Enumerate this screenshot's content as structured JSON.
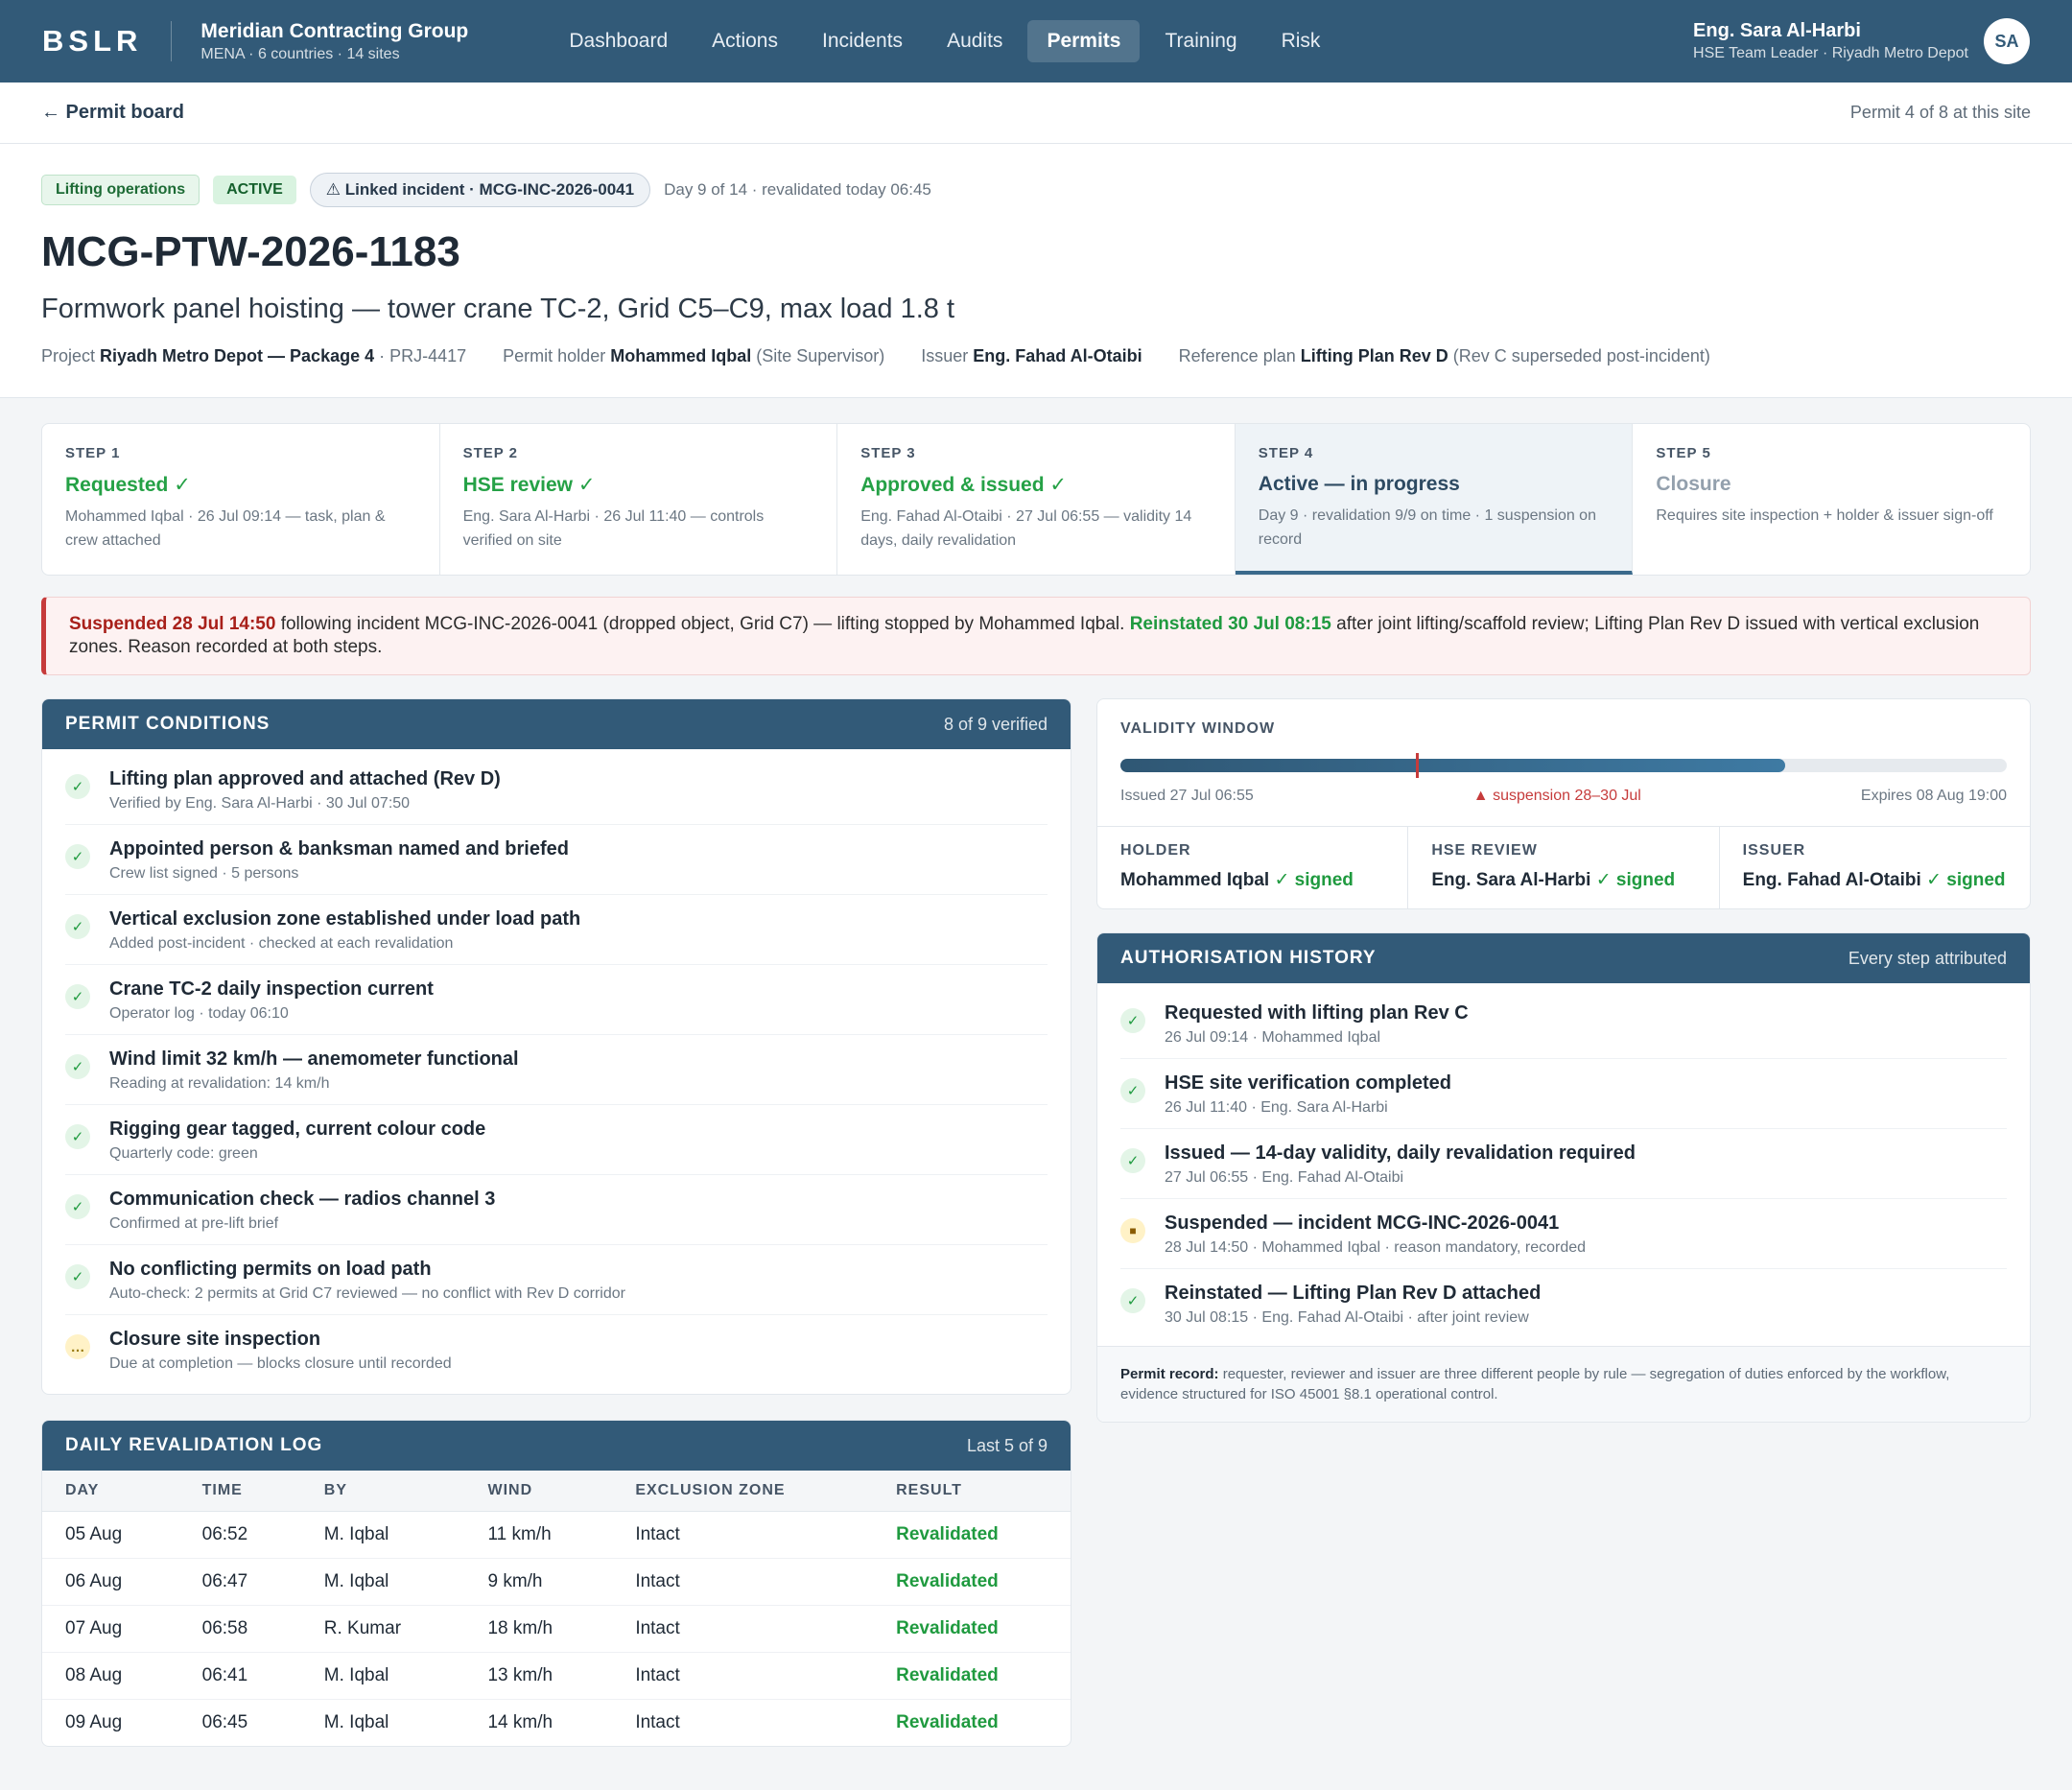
{
  "topbar": {
    "logo": "BSLR",
    "org_name": "Meridian Contracting Group",
    "org_sub": "MENA · 6 countries · 14 sites",
    "nav": [
      "Dashboard",
      "Actions",
      "Incidents",
      "Audits",
      "Permits",
      "Training",
      "Risk"
    ],
    "active_nav": "Permits",
    "user_name": "Eng. Sara Al-Harbi",
    "user_role": "HSE Team Leader · Riyadh Metro Depot",
    "avatar": "SA"
  },
  "subbar": {
    "back": "← Permit board",
    "position": "Permit 4 of 8 at this site"
  },
  "header": {
    "tag_type": "Lifting operations",
    "tag_status": "ACTIVE",
    "tag_incident": "⚠ Linked incident · MCG-INC-2026-0041",
    "day_meta": "Day 9 of 14 · revalidated today 06:45",
    "title": "MCG-PTW-2026-1183",
    "subtitle": "Formwork panel hoisting — tower crane TC-2, Grid C5–C9, max load 1.8 t",
    "project_label": "Project ",
    "project_value": "Riyadh Metro Depot — Package 4",
    "project_code": " · PRJ-4417",
    "holder_label": "Permit holder ",
    "holder_value": "Mohammed Iqbal",
    "holder_role": " (Site Supervisor)",
    "issuer_label": "Issuer ",
    "issuer_value": "Eng. Fahad Al-Otaibi",
    "plan_label": "Reference plan ",
    "plan_value": "Lifting Plan Rev D",
    "plan_note": " (Rev C superseded post-incident)"
  },
  "steps": [
    {
      "num": "STEP 1",
      "title": "Requested ✓",
      "desc": "Mohammed Iqbal · 26 Jul 09:14 — task, plan & crew attached",
      "state": "done"
    },
    {
      "num": "STEP 2",
      "title": "HSE review ✓",
      "desc": "Eng. Sara Al-Harbi · 26 Jul 11:40 — controls verified on site",
      "state": "done"
    },
    {
      "num": "STEP 3",
      "title": "Approved & issued ✓",
      "desc": "Eng. Fahad Al-Otaibi · 27 Jul 06:55 — validity 14 days, daily revalidation",
      "state": "done"
    },
    {
      "num": "STEP 4",
      "title": "Active — in progress",
      "desc": "Day 9 · revalidation 9/9 on time · 1 suspension on record",
      "state": "current"
    },
    {
      "num": "STEP 5",
      "title": "Closure",
      "desc": "Requires site inspection + holder & issuer sign-off",
      "state": "pending"
    }
  ],
  "alert": {
    "susp": "Suspended 28 Jul 14:50",
    "text1": " following incident MCG-INC-2026-0041 (dropped object, Grid C7) — lifting stopped by Mohammed Iqbal. ",
    "reinst": "Reinstated 30 Jul 08:15",
    "text2": " after joint lifting/scaffold review; Lifting Plan Rev D issued with vertical exclusion zones. Reason recorded at both steps."
  },
  "conditions": {
    "title": "PERMIT CONDITIONS",
    "aside": "8 of 9 verified",
    "items": [
      {
        "title": "Lifting plan approved and attached (Rev D)",
        "sub": "Verified by Eng. Sara Al-Harbi · 30 Jul 07:50",
        "icon": "✓"
      },
      {
        "title": "Appointed person & banksman named and briefed",
        "sub": "Crew list signed · 5 persons",
        "icon": "✓"
      },
      {
        "title": "Vertical exclusion zone established under load path",
        "sub": "Added post-incident · checked at each revalidation",
        "icon": "✓"
      },
      {
        "title": "Crane TC-2 daily inspection current",
        "sub": "Operator log · today 06:10",
        "icon": "✓"
      },
      {
        "title": "Wind limit 32 km/h — anemometer functional",
        "sub": "Reading at revalidation: 14 km/h",
        "icon": "✓"
      },
      {
        "title": "Rigging gear tagged, current colour code",
        "sub": "Quarterly code: green",
        "icon": "✓"
      },
      {
        "title": "Communication check — radios channel 3",
        "sub": "Confirmed at pre-lift brief",
        "icon": "✓"
      },
      {
        "title": "No conflicting permits on load path",
        "sub": "Auto-check: 2 permits at Grid C7 reviewed — no conflict with Rev D corridor",
        "icon": "✓"
      },
      {
        "title": "Closure site inspection",
        "sub": "Due at completion — blocks closure until recorded",
        "icon": "…"
      }
    ]
  },
  "reval": {
    "title": "DAILY REVALIDATION LOG",
    "aside": "Last 5 of 9",
    "headers": [
      "DAY",
      "TIME",
      "BY",
      "WIND",
      "EXCLUSION ZONE",
      "RESULT"
    ],
    "rows": [
      [
        "05 Aug",
        "06:52",
        "M. Iqbal",
        "11 km/h",
        "Intact",
        "Revalidated"
      ],
      [
        "06 Aug",
        "06:47",
        "M. Iqbal",
        "9 km/h",
        "Intact",
        "Revalidated"
      ],
      [
        "07 Aug",
        "06:58",
        "R. Kumar",
        "18 km/h",
        "Intact",
        "Revalidated"
      ],
      [
        "08 Aug",
        "06:41",
        "M. Iqbal",
        "13 km/h",
        "Intact",
        "Revalidated"
      ],
      [
        "09 Aug",
        "06:45",
        "M. Iqbal",
        "14 km/h",
        "Intact",
        "Revalidated"
      ]
    ]
  },
  "validity": {
    "title": "VALIDITY WINDOW",
    "progress_fraction": 0.75,
    "suspension_fraction": 0.333,
    "issued": "Issued 27 Jul 06:55",
    "suspension": "▲ suspension 28–30 Jul",
    "expires": "Expires 08 Aug 19:00",
    "signers": [
      {
        "label": "HOLDER",
        "name": "Mohammed Iqbal",
        "status": " ✓ signed"
      },
      {
        "label": "HSE REVIEW",
        "name": "Eng. Sara Al-Harbi",
        "status": " ✓ signed"
      },
      {
        "label": "ISSUER",
        "name": "Eng. Fahad Al-Otaibi",
        "status": " ✓ signed"
      }
    ]
  },
  "auth": {
    "title": "AUTHORISATION HISTORY",
    "aside": "Every step attributed",
    "items": [
      {
        "title": "Requested with lifting plan Rev C",
        "sub": "26 Jul 09:14 · Mohammed Iqbal",
        "icon": "✓"
      },
      {
        "title": "HSE site verification completed",
        "sub": "26 Jul 11:40 · Eng. Sara Al-Harbi",
        "icon": "✓"
      },
      {
        "title": "Issued — 14-day validity, daily revalidation required",
        "sub": "27 Jul 06:55 · Eng. Fahad Al-Otaibi",
        "icon": "✓"
      },
      {
        "title": "Suspended — incident MCG-INC-2026-0041",
        "sub": "28 Jul 14:50 · Mohammed Iqbal · reason mandatory, recorded",
        "icon": "■"
      },
      {
        "title": "Reinstated — Lifting Plan Rev D attached",
        "sub": "30 Jul 08:15 · Eng. Fahad Al-Otaibi · after joint review",
        "icon": "✓"
      }
    ],
    "foot_label": "Permit record:",
    "foot_text": " requester, reviewer and issuer are three different people by rule — segregation of duties enforced by the workflow, evidence structured for ISO 45001 §8.1 operational control."
  }
}
